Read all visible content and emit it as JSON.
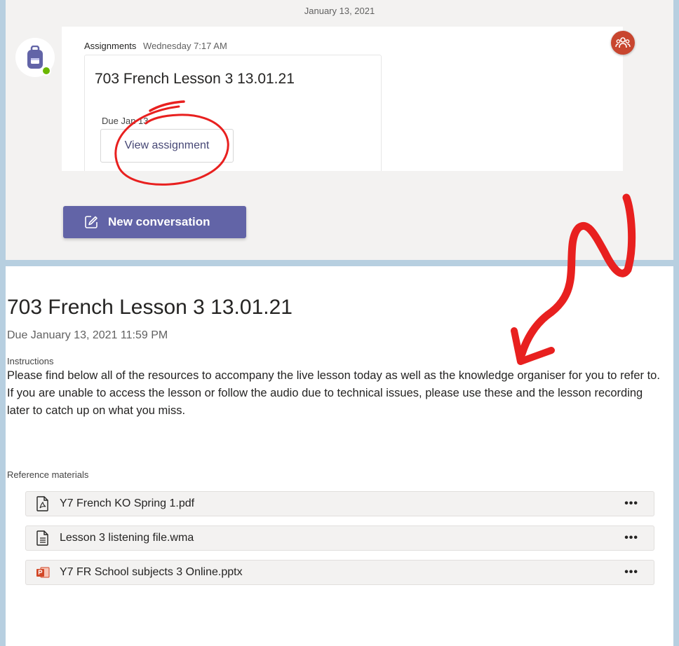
{
  "channel": {
    "date_divider": "January 13, 2021",
    "post": {
      "author": "Assignments",
      "timestamp": "Wednesday 7:17 AM",
      "assignment_title": "703 French Lesson 3 13.01.21",
      "due_short": "Due Jan 13",
      "view_button_label": "View assignment"
    },
    "new_conversation_label": "New conversation",
    "colors": {
      "brand": "#6264a7",
      "team_avatar": "#c8462f",
      "presence": "#6bb700"
    }
  },
  "assignment": {
    "title": "703 French Lesson 3 13.01.21",
    "due_full": "Due January 13, 2021 11:59 PM",
    "instructions_label": "Instructions",
    "instructions_text": "Please find below all of the resources to accompany the live lesson today as well as the knowledge organiser for you to refer to.  If you are unable to access the lesson or follow the audio due to technical issues, please use these and the lesson recording later to catch up on what you miss.",
    "reference_label": "Reference materials",
    "files": [
      {
        "name": "Y7 French KO Spring 1.pdf",
        "icon": "pdf-file-icon",
        "more": "•••"
      },
      {
        "name": "Lesson 3 listening file.wma",
        "icon": "document-file-icon",
        "more": "•••"
      },
      {
        "name": "Y7 FR School subjects 3 Online.pptx",
        "icon": "powerpoint-file-icon",
        "more": "•••"
      }
    ]
  },
  "annotation_color": "#e8201f"
}
